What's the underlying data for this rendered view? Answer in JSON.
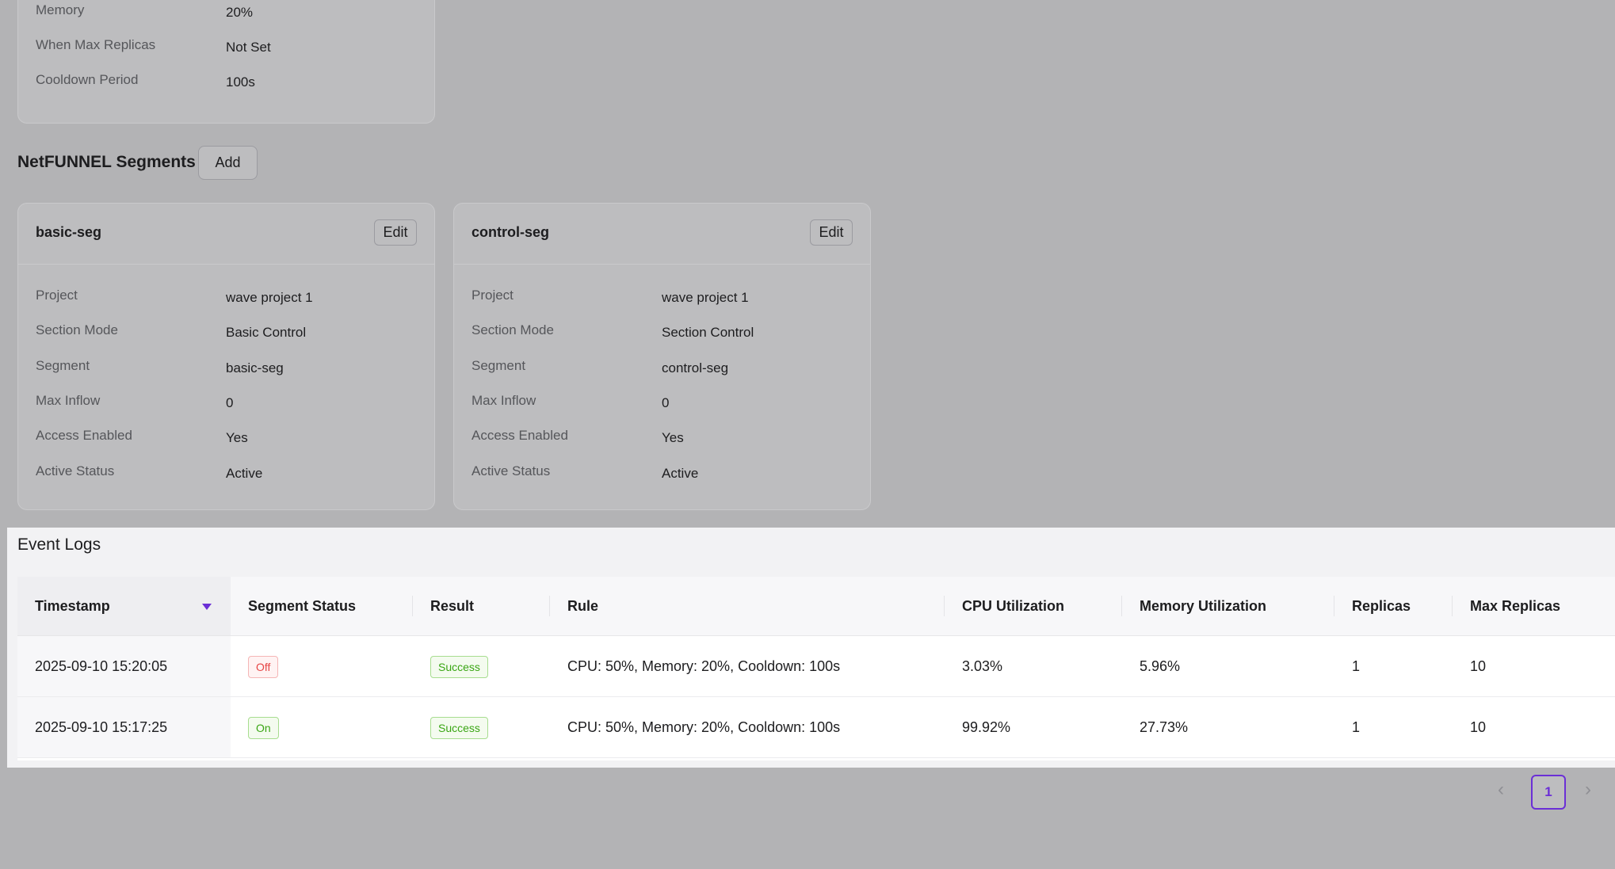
{
  "scaling_card": {
    "rows": [
      {
        "label": "Memory",
        "value": "20%"
      },
      {
        "label": "When Max Replicas",
        "value": "Not Set"
      },
      {
        "label": "Cooldown Period",
        "value": "100s"
      }
    ]
  },
  "segments_section": {
    "title": "NetFUNNEL Segments",
    "add_label": "Add",
    "cards": [
      {
        "name": "basic-seg",
        "edit_label": "Edit",
        "rows": [
          {
            "label": "Project",
            "value": "wave project 1"
          },
          {
            "label": "Section Mode",
            "value": "Basic Control"
          },
          {
            "label": "Segment",
            "value": "basic-seg"
          },
          {
            "label": "Max Inflow",
            "value": "0"
          },
          {
            "label": "Access Enabled",
            "value": "Yes"
          },
          {
            "label": "Active Status",
            "value": "Active"
          }
        ]
      },
      {
        "name": "control-seg",
        "edit_label": "Edit",
        "rows": [
          {
            "label": "Project",
            "value": "wave project 1"
          },
          {
            "label": "Section Mode",
            "value": "Section Control"
          },
          {
            "label": "Segment",
            "value": "control-seg"
          },
          {
            "label": "Max Inflow",
            "value": "0"
          },
          {
            "label": "Access Enabled",
            "value": "Yes"
          },
          {
            "label": "Active Status",
            "value": "Active"
          }
        ]
      }
    ]
  },
  "event_logs": {
    "title": "Event Logs",
    "columns": [
      "Timestamp",
      "Segment Status",
      "Result",
      "Rule",
      "CPU Utilization",
      "Memory Utilization",
      "Replicas",
      "Max Replicas"
    ],
    "rows": [
      {
        "timestamp": "2025-09-10 15:20:05",
        "segment_status": "Off",
        "result": "Success",
        "rule": "CPU: 50%, Memory: 20%, Cooldown: 100s",
        "cpu": "3.03%",
        "memory": "5.96%",
        "replicas": "1",
        "max_replicas": "10"
      },
      {
        "timestamp": "2025-09-10 15:17:25",
        "segment_status": "On",
        "result": "Success",
        "rule": "CPU: 50%, Memory: 20%, Cooldown: 100s",
        "cpu": "99.92%",
        "memory": "27.73%",
        "replicas": "1",
        "max_replicas": "10"
      }
    ]
  },
  "pagination": {
    "prev_icon": "‹",
    "current_page": "1",
    "next_icon": "›"
  },
  "colors": {
    "accent": "#6b2fd6",
    "off_tag": "#e64545",
    "success_tag": "#3aa614"
  }
}
